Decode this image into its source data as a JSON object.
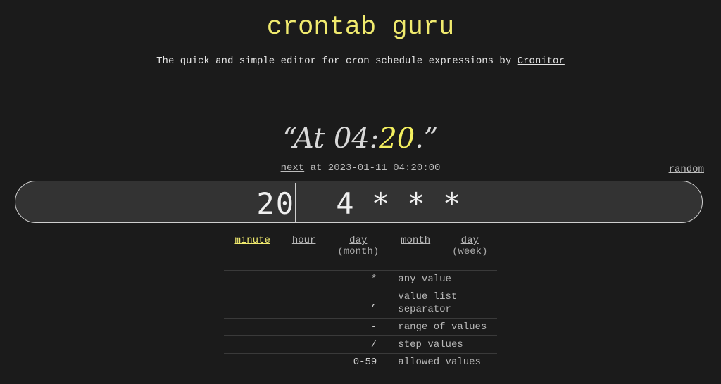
{
  "header": {
    "title": "crontab guru",
    "subtitle_prefix": "The quick and simple editor for cron schedule expressions by",
    "subtitle_link": "Cronitor"
  },
  "description": {
    "open_quote": "“",
    "prefix": "At 04:",
    "highlight": "20",
    "suffix": ".",
    "close_quote": "”"
  },
  "next_run": {
    "link": "next",
    "text": " at 2023-01-11 04:20:00"
  },
  "random_label": "random",
  "expression": {
    "minute": "20",
    "rest": " 4 * * *"
  },
  "accent_color": "#f0ea6e",
  "parts": [
    {
      "label": "minute",
      "sub": "",
      "active": true
    },
    {
      "label": "hour",
      "sub": "",
      "active": false
    },
    {
      "label": "day",
      "sub": "(month)",
      "active": false
    },
    {
      "label": "month",
      "sub": "",
      "active": false
    },
    {
      "label": "day",
      "sub": "(week)",
      "active": false
    }
  ],
  "legend": [
    {
      "symbol": "*",
      "desc": "any value"
    },
    {
      "symbol": ",",
      "desc": "value list separator"
    },
    {
      "symbol": "-",
      "desc": "range of values"
    },
    {
      "symbol": "/",
      "desc": "step values"
    },
    {
      "symbol": "0-59",
      "desc": "allowed values"
    }
  ]
}
